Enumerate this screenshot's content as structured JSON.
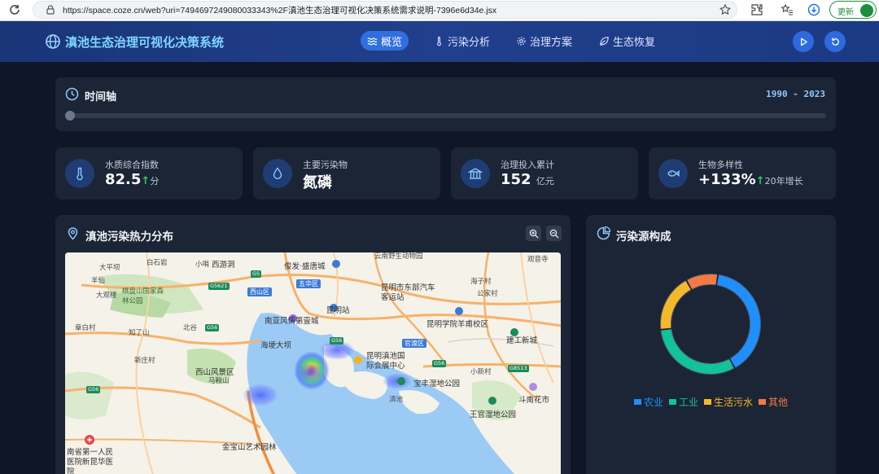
{
  "browser": {
    "url": "https://space.coze.cn/web?uri=7494697249080033343%2F滇池生态治理可视化决策系统需求说明-7396e6d34e.jsx",
    "update_label": "更新"
  },
  "header": {
    "title": "滇池生态治理可视化决策系统",
    "nav": [
      {
        "label": "概览",
        "active": true
      },
      {
        "label": "污染分析",
        "active": false
      },
      {
        "label": "治理方案",
        "active": false
      },
      {
        "label": "生态恢复",
        "active": false
      }
    ]
  },
  "timeline": {
    "title": "时间轴",
    "range": "1990 - 2023",
    "position_fraction": 0
  },
  "stats": [
    {
      "label": "水质综合指数",
      "value": "82.5",
      "trend": "↑",
      "unit": "分",
      "icon": "thermometer-icon"
    },
    {
      "label": "主要污染物",
      "value": "氮磷",
      "trend": "",
      "unit": "",
      "icon": "droplet-icon"
    },
    {
      "label": "治理投入累计",
      "value": "152",
      "trend": "",
      "unit": "亿元",
      "icon": "bank-icon"
    },
    {
      "label": "生物多样性",
      "value": "+133%",
      "trend": "↑",
      "unit": "20年增长",
      "icon": "fish-icon"
    }
  ],
  "map": {
    "title": "滇池污染热力分布",
    "labels": [
      {
        "t": "西游洞",
        "cls": "big"
      },
      {
        "t": "俊发·盛唐城",
        "cls": "big"
      },
      {
        "t": "云南野生动物园",
        "cls": ""
      },
      {
        "t": "大平坝",
        "cls": ""
      },
      {
        "t": "白石岩",
        "cls": ""
      },
      {
        "t": "小哨",
        "cls": ""
      },
      {
        "t": "羊仙",
        "cls": ""
      },
      {
        "t": "大观楼",
        "cls": ""
      },
      {
        "t": "棋盘山国家森林公园",
        "cls": ""
      },
      {
        "t": "西山区",
        "cls": "big"
      },
      {
        "t": "五华区",
        "cls": "big"
      },
      {
        "t": "昆明市东部汽车客运站",
        "cls": "big"
      },
      {
        "t": "昆明站",
        "cls": "big"
      },
      {
        "t": "南亚风情第壹城",
        "cls": "big"
      },
      {
        "t": "昆明学院羊甫校区",
        "cls": "big"
      },
      {
        "t": "海埂大坝",
        "cls": "big"
      },
      {
        "t": "官渡区",
        "cls": "big"
      },
      {
        "t": "昆明滇池国际会展中心",
        "cls": "big"
      },
      {
        "t": "建工新城",
        "cls": "big"
      },
      {
        "t": "西山风景区",
        "cls": "big"
      },
      {
        "t": "马鞍山",
        "cls": ""
      },
      {
        "t": "宝丰湿地公园",
        "cls": "big"
      },
      {
        "t": "滇池",
        "cls": ""
      },
      {
        "t": "斗南花市",
        "cls": "big"
      },
      {
        "t": "王官湿地公园",
        "cls": "big"
      },
      {
        "t": "南省第一人民医院新昆华医院",
        "cls": "big"
      },
      {
        "t": "金宝山艺术园林",
        "cls": "big"
      },
      {
        "t": "章白村",
        "cls": ""
      },
      {
        "t": "知了山",
        "cls": ""
      },
      {
        "t": "北谷",
        "cls": ""
      },
      {
        "t": "新庄村",
        "cls": ""
      },
      {
        "t": "海子村",
        "cls": ""
      },
      {
        "t": "公家村",
        "cls": ""
      },
      {
        "t": "小新村",
        "cls": ""
      },
      {
        "t": "观音寺",
        "cls": ""
      }
    ],
    "shields": [
      "G5",
      "G5621",
      "G56",
      "G56",
      "G56",
      "G8513",
      "G56"
    ],
    "hotspots": [
      {
        "name": "haigeng",
        "intensity": 1.0
      },
      {
        "name": "exhibition",
        "intensity": 0.55
      },
      {
        "name": "west-bay",
        "intensity": 0.6
      },
      {
        "name": "center",
        "intensity": 0.65
      },
      {
        "name": "baofeng",
        "intensity": 0.45
      }
    ]
  },
  "pollution": {
    "title": "污染源构成"
  },
  "chart_data": {
    "type": "pie",
    "categories": [
      "农业",
      "工业",
      "生活污水",
      "其他"
    ],
    "values": [
      38,
      30,
      18,
      10
    ],
    "colors": [
      "#1e8fff",
      "#12c29a",
      "#f4b92a",
      "#f47a45"
    ],
    "legend": "bottom",
    "title": "污染源构成"
  },
  "colors": {
    "background": "#0f1727",
    "panel": "#1c2535",
    "header": "#1c3a83",
    "accent": "#2f6fe0",
    "title": "#7fd6ff",
    "up": "#2ecc71"
  }
}
